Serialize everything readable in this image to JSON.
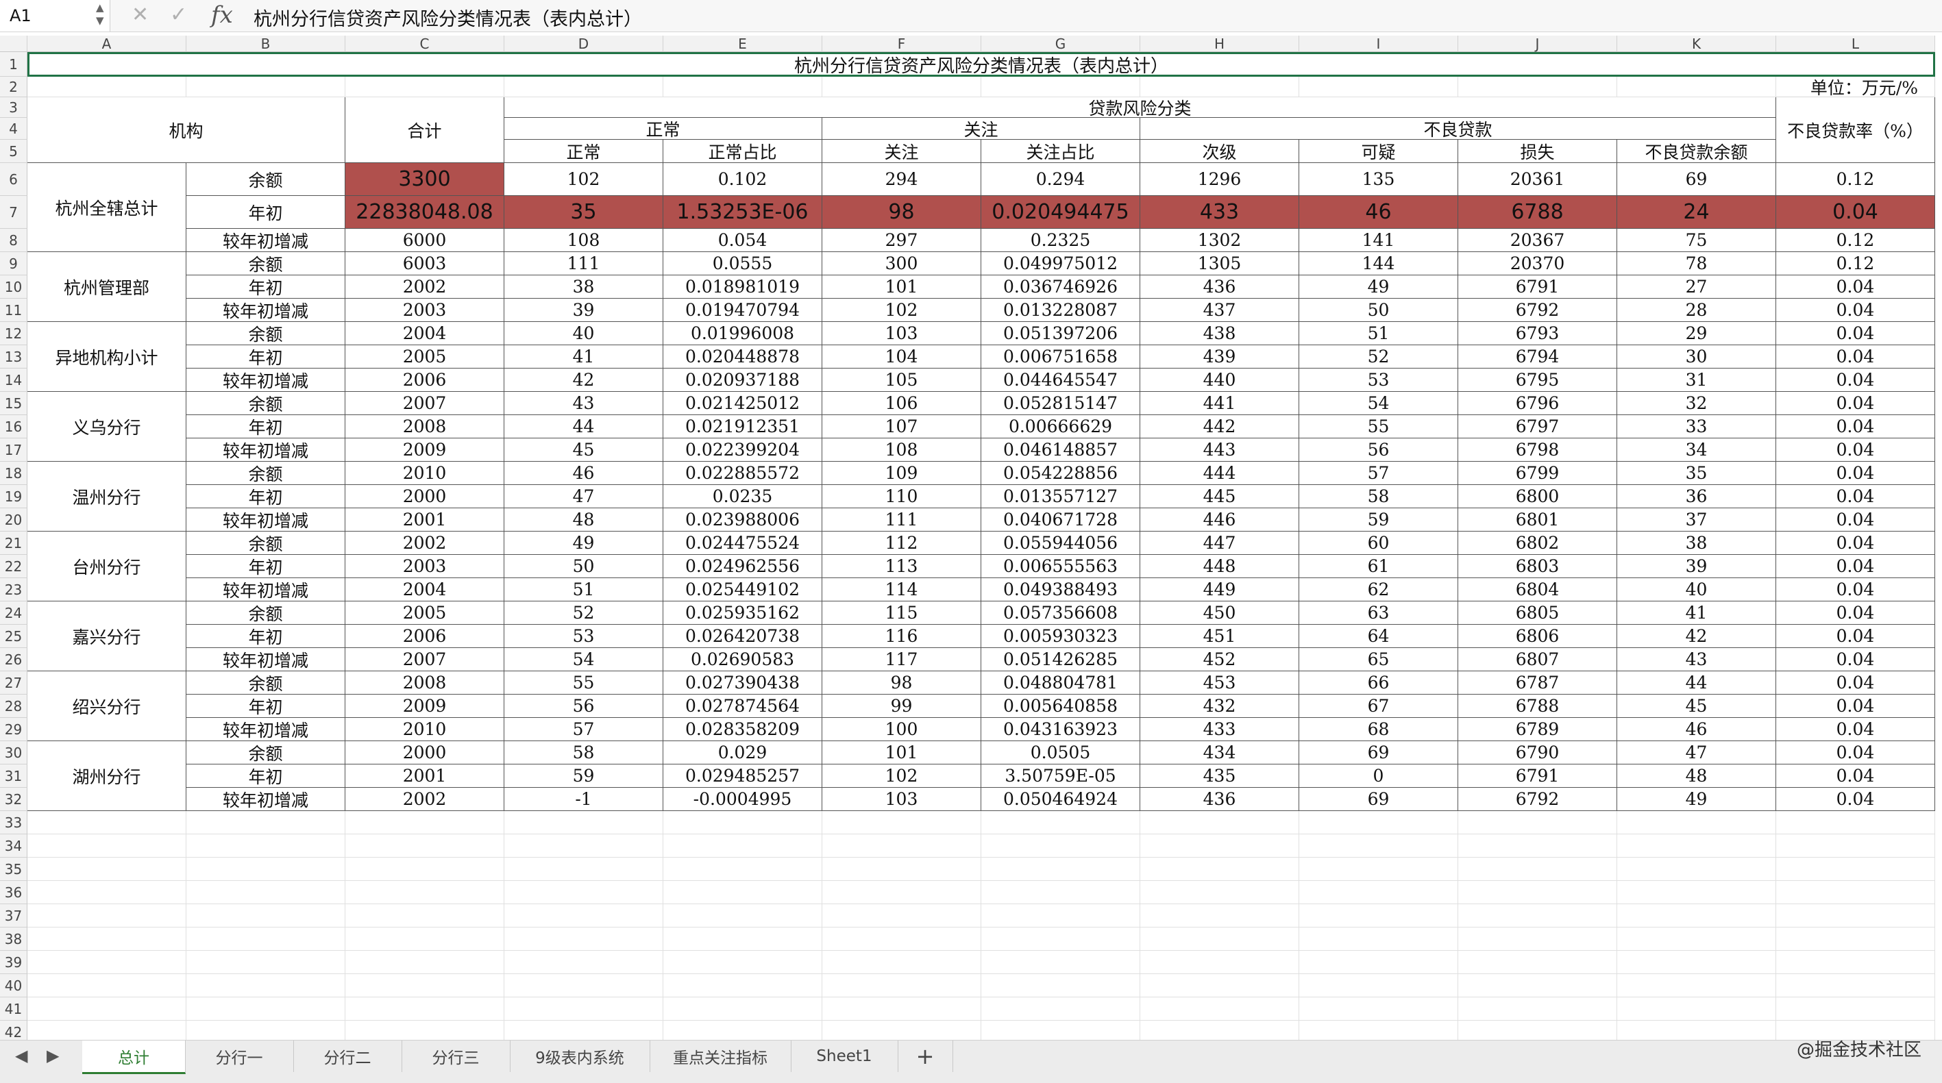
{
  "formula_bar": {
    "name_box": "A1",
    "cancel_icon": "✕",
    "confirm_icon": "✓",
    "fx_label": "fx",
    "formula": "杭州分行信贷资产风险分类情况表（表内总计）"
  },
  "columns": [
    "A",
    "B",
    "C",
    "D",
    "E",
    "F",
    "G",
    "H",
    "I",
    "J",
    "K",
    "L"
  ],
  "row_numbers": [
    "1",
    "2",
    "3",
    "4",
    "5",
    "6",
    "7",
    "8",
    "9",
    "10",
    "11",
    "12",
    "13",
    "14",
    "15",
    "16",
    "17",
    "18",
    "19",
    "20",
    "21",
    "22",
    "23",
    "24",
    "25",
    "26",
    "27",
    "28",
    "29",
    "30",
    "31",
    "32",
    "33",
    "34",
    "35",
    "36",
    "37",
    "38",
    "39",
    "40",
    "41",
    "42"
  ],
  "sheet": {
    "title": "杭州分行信贷资产风险分类情况表（表内总计）",
    "unit": "单位：万元/%",
    "header": {
      "org": "机构",
      "total": "合计",
      "risk_class": "贷款风险分类",
      "normal_group": "正常",
      "attention_group": "关注",
      "npl_group": "不良贷款",
      "npl_rate": "不良贷款率（%）",
      "sub": [
        "正常",
        "正常占比",
        "关注",
        "关注占比",
        "次级",
        "可疑",
        "损失",
        "不良贷款余额"
      ]
    },
    "groups": [
      "杭州全辖总计",
      "杭州管理部",
      "异地机构小计",
      "义乌分行",
      "温州分行",
      "台州分行",
      "嘉兴分行",
      "绍兴分行",
      "湖州分行"
    ],
    "rows": [
      [
        "余额",
        "3300",
        "102",
        "0.102",
        "294",
        "0.294",
        "1296",
        "135",
        "20361",
        "69",
        "0.12"
      ],
      [
        "年初",
        "22838048.08",
        "35",
        "1.53253E-06",
        "98",
        "0.020494475",
        "433",
        "46",
        "6788",
        "24",
        "0.04"
      ],
      [
        "较年初增减",
        "6000",
        "108",
        "0.054",
        "297",
        "0.2325",
        "1302",
        "141",
        "20367",
        "75",
        "0.12"
      ],
      [
        "余额",
        "6003",
        "111",
        "0.0555",
        "300",
        "0.049975012",
        "1305",
        "144",
        "20370",
        "78",
        "0.12"
      ],
      [
        "年初",
        "2002",
        "38",
        "0.018981019",
        "101",
        "0.036746926",
        "436",
        "49",
        "6791",
        "27",
        "0.04"
      ],
      [
        "较年初增减",
        "2003",
        "39",
        "0.019470794",
        "102",
        "0.013228087",
        "437",
        "50",
        "6792",
        "28",
        "0.04"
      ],
      [
        "余额",
        "2004",
        "40",
        "0.01996008",
        "103",
        "0.051397206",
        "438",
        "51",
        "6793",
        "29",
        "0.04"
      ],
      [
        "年初",
        "2005",
        "41",
        "0.020448878",
        "104",
        "0.006751658",
        "439",
        "52",
        "6794",
        "30",
        "0.04"
      ],
      [
        "较年初增减",
        "2006",
        "42",
        "0.020937188",
        "105",
        "0.044645547",
        "440",
        "53",
        "6795",
        "31",
        "0.04"
      ],
      [
        "余额",
        "2007",
        "43",
        "0.021425012",
        "106",
        "0.052815147",
        "441",
        "54",
        "6796",
        "32",
        "0.04"
      ],
      [
        "年初",
        "2008",
        "44",
        "0.021912351",
        "107",
        "0.00666629",
        "442",
        "55",
        "6797",
        "33",
        "0.04"
      ],
      [
        "较年初增减",
        "2009",
        "45",
        "0.022399204",
        "108",
        "0.046148857",
        "443",
        "56",
        "6798",
        "34",
        "0.04"
      ],
      [
        "余额",
        "2010",
        "46",
        "0.022885572",
        "109",
        "0.054228856",
        "444",
        "57",
        "6799",
        "35",
        "0.04"
      ],
      [
        "年初",
        "2000",
        "47",
        "0.0235",
        "110",
        "0.013557127",
        "445",
        "58",
        "6800",
        "36",
        "0.04"
      ],
      [
        "较年初增减",
        "2001",
        "48",
        "0.023988006",
        "111",
        "0.040671728",
        "446",
        "59",
        "6801",
        "37",
        "0.04"
      ],
      [
        "余额",
        "2002",
        "49",
        "0.024475524",
        "112",
        "0.055944056",
        "447",
        "60",
        "6802",
        "38",
        "0.04"
      ],
      [
        "年初",
        "2003",
        "50",
        "0.024962556",
        "113",
        "0.006555563",
        "448",
        "61",
        "6803",
        "39",
        "0.04"
      ],
      [
        "较年初增减",
        "2004",
        "51",
        "0.025449102",
        "114",
        "0.049388493",
        "449",
        "62",
        "6804",
        "40",
        "0.04"
      ],
      [
        "余额",
        "2005",
        "52",
        "0.025935162",
        "115",
        "0.057356608",
        "450",
        "63",
        "6805",
        "41",
        "0.04"
      ],
      [
        "年初",
        "2006",
        "53",
        "0.026420738",
        "116",
        "0.005930323",
        "451",
        "64",
        "6806",
        "42",
        "0.04"
      ],
      [
        "较年初增减",
        "2007",
        "54",
        "0.02690583",
        "117",
        "0.051426285",
        "452",
        "65",
        "6807",
        "43",
        "0.04"
      ],
      [
        "余额",
        "2008",
        "55",
        "0.027390438",
        "98",
        "0.048804781",
        "453",
        "66",
        "6787",
        "44",
        "0.04"
      ],
      [
        "年初",
        "2009",
        "56",
        "0.027874564",
        "99",
        "0.005640858",
        "432",
        "67",
        "6788",
        "45",
        "0.04"
      ],
      [
        "较年初增减",
        "2010",
        "57",
        "0.028358209",
        "100",
        "0.043163923",
        "433",
        "68",
        "6789",
        "46",
        "0.04"
      ],
      [
        "余额",
        "2000",
        "58",
        "0.029",
        "101",
        "0.0505",
        "434",
        "69",
        "6790",
        "47",
        "0.04"
      ],
      [
        "年初",
        "2001",
        "59",
        "0.029485257",
        "102",
        "3.50759E-05",
        "435",
        "0",
        "6791",
        "48",
        "0.04"
      ],
      [
        "较年初增减",
        "2002",
        "-1",
        "-0.0004995",
        "103",
        "0.050464924",
        "436",
        "69",
        "6792",
        "49",
        "0.04"
      ]
    ]
  },
  "highlight_color": "#b0504d",
  "tabs": [
    "总计",
    "分行一",
    "分行二",
    "分行三",
    "9级表内系统",
    "重点关注指标",
    "Sheet1"
  ],
  "active_tab": "总计",
  "add_sheet": "+",
  "nav_prev": "◀",
  "nav_next": "▶",
  "watermark": "@掘金技术社区"
}
